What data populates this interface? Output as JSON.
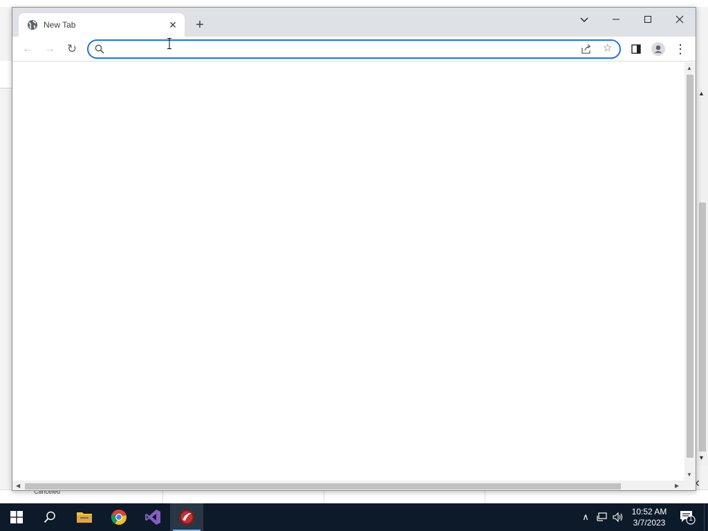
{
  "background": {
    "status_text": "Canceled"
  },
  "browser": {
    "tab": {
      "title": "New Tab",
      "favicon": "globe-icon",
      "close": "✕"
    },
    "new_tab": "+",
    "window_controls": {
      "tab_search": "chevron-down-icon",
      "minimize": "—",
      "maximize": "☐",
      "close": "✕"
    },
    "toolbar": {
      "back": "←",
      "forward": "→",
      "reload": "↻",
      "omnibox": {
        "value": "",
        "placeholder": ""
      },
      "menu": "⋮"
    }
  },
  "taskbar": {
    "apps": [
      "start-button",
      "search-icon",
      "file-explorer-icon",
      "chrome-icon",
      "visual-studio-icon",
      "app-icon"
    ],
    "tray": {
      "chevron": "∧",
      "clock_time": "10:52 AM",
      "clock_date": "3/7/2023",
      "notification_count": "1"
    }
  },
  "colors": {
    "accent": "#1a73e8",
    "tabstrip": "#dee1e6",
    "taskbar": "#0c1a2a",
    "vs_purple": "#865fc5",
    "folder_yellow": "#f4c13d"
  }
}
